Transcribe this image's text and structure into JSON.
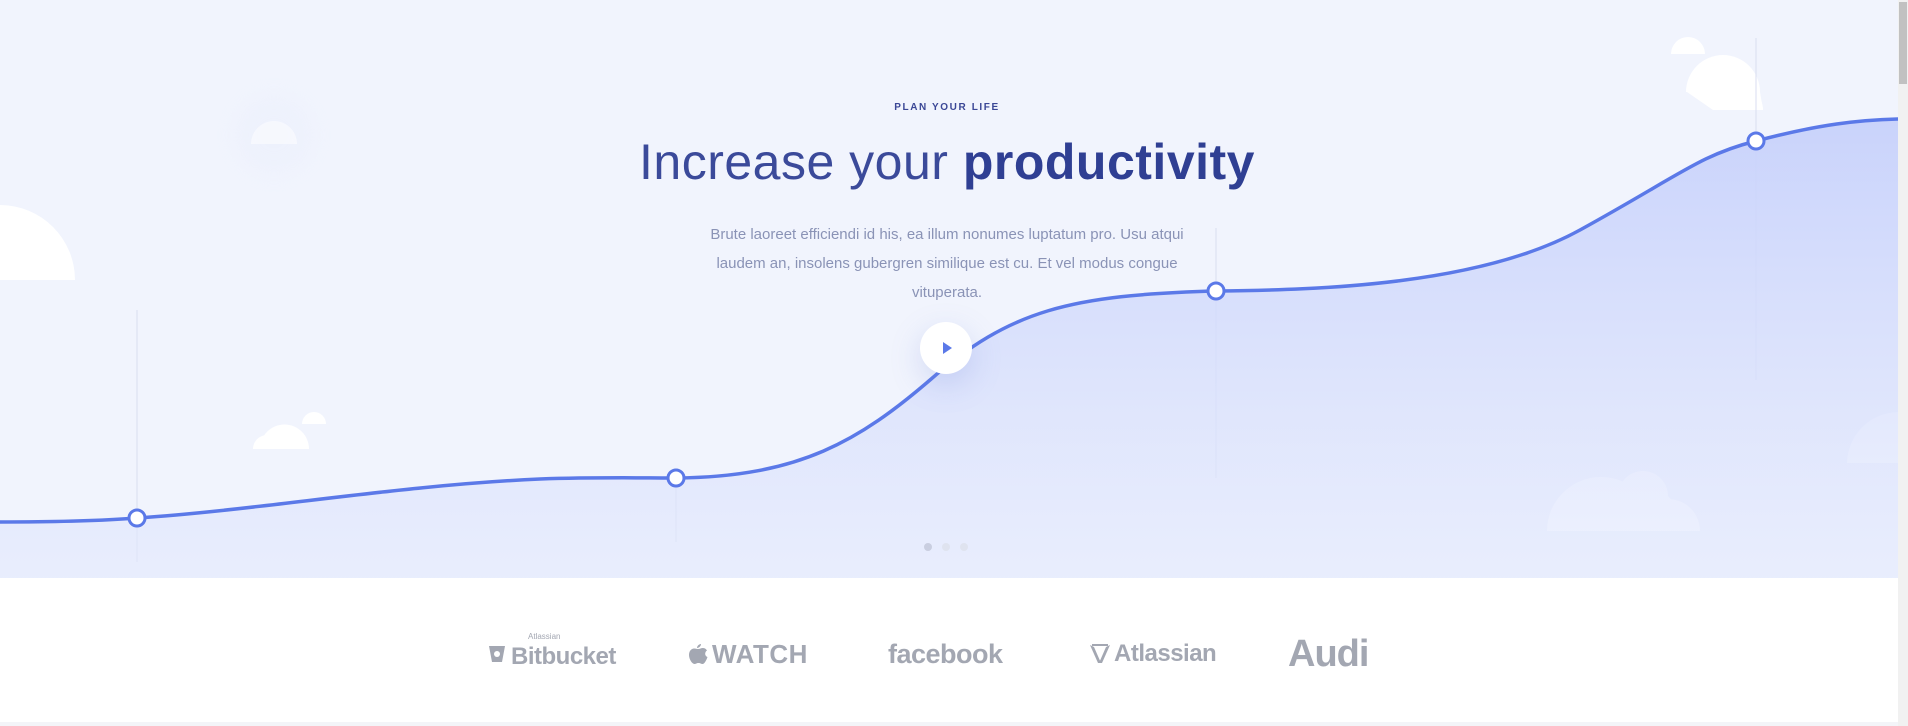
{
  "hero": {
    "eyebrow": "PLAN YOUR LIFE",
    "headline_light": "Increase your ",
    "headline_bold": "productivity",
    "description": "Brute laoreet efficiendi id his, ea illum nonumes luptatum pro. Usu atqui laudem an, insolens gubergren similique est cu. Et vel modus congue vituperata.",
    "slides_count": 3,
    "active_slide": 1,
    "colors": {
      "background": "#f1f4fd",
      "curve": "#5b79e8",
      "heading": "#3b4a9a",
      "text": "#8a93b6"
    }
  },
  "logos": [
    {
      "name": "Bitbucket",
      "small": "Atlassian"
    },
    {
      "name": "WATCH"
    },
    {
      "name": "facebook"
    },
    {
      "name": "Atlassian"
    },
    {
      "name": "Audi"
    }
  ]
}
